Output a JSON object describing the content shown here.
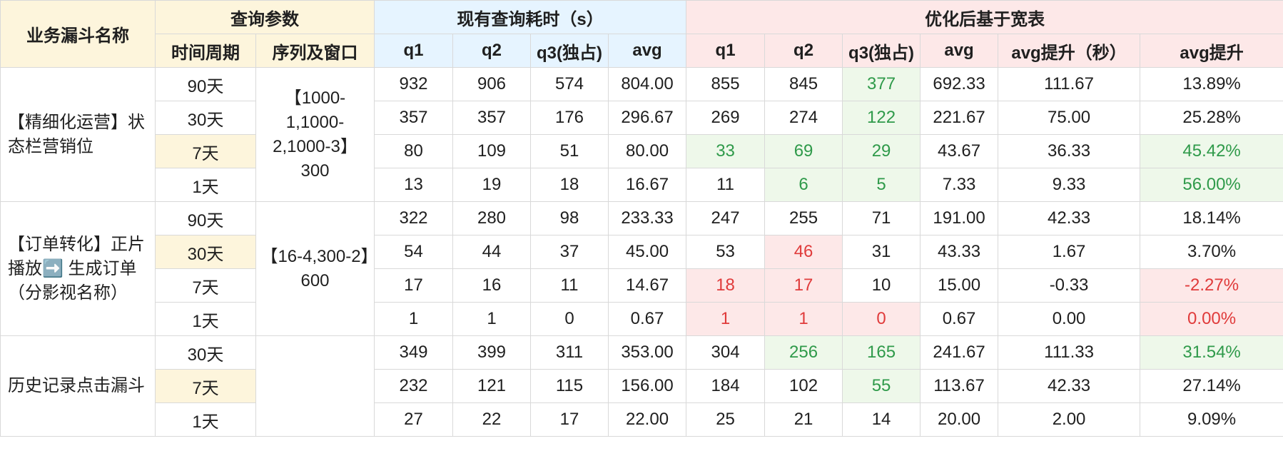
{
  "headers": {
    "business": "业务漏斗名称",
    "query_params": "查询参数",
    "current": "现有查询耗时（s）",
    "optimized": "优化后基于宽表",
    "period": "时间周期",
    "sequence_window": "序列及窗口",
    "current_cols": [
      "q1",
      "q2",
      "q3(独占)",
      "avg"
    ],
    "optimized_cols": [
      "q1",
      "q2",
      "q3(独占)",
      "avg",
      "avg提升（秒）",
      "avg提升"
    ]
  },
  "colors": {
    "header_yellow": "#fdf5dc",
    "header_blue": "#e6f4ff",
    "header_pink": "#fde8e8",
    "highlight_green_bg": "#eef8ea",
    "highlight_green_text": "#2f9a4a",
    "highlight_red_bg": "#fde8e8",
    "highlight_red_text": "#e03b3b"
  },
  "groups": [
    {
      "name": "【精细化运营】状态栏营销位",
      "param": "【1000-1,1000-2,1000-3】300",
      "rows": [
        {
          "period": "90天",
          "cur": [
            "932",
            "906",
            "574",
            "804.00"
          ],
          "opt": [
            "855",
            "845",
            "377",
            "692.33",
            "111.67",
            "13.89%"
          ]
        },
        {
          "period": "30天",
          "cur": [
            "357",
            "357",
            "176",
            "296.67"
          ],
          "opt": [
            "269",
            "274",
            "122",
            "221.67",
            "75.00",
            "25.28%"
          ]
        },
        {
          "period": "7天",
          "cur": [
            "80",
            "109",
            "51",
            "80.00"
          ],
          "opt": [
            "33",
            "69",
            "29",
            "43.67",
            "36.33",
            "45.42%"
          ]
        },
        {
          "period": "1天",
          "cur": [
            "13",
            "19",
            "18",
            "16.67"
          ],
          "opt": [
            "11",
            "6",
            "5",
            "7.33",
            "9.33",
            "56.00%"
          ]
        }
      ]
    },
    {
      "name": "【订单转化】正片播放➡️ 生成订单（分影视名称）",
      "param": "【16-4,300-2】600",
      "rows": [
        {
          "period": "90天",
          "cur": [
            "322",
            "280",
            "98",
            "233.33"
          ],
          "opt": [
            "247",
            "255",
            "71",
            "191.00",
            "42.33",
            "18.14%"
          ]
        },
        {
          "period": "30天",
          "cur": [
            "54",
            "44",
            "37",
            "45.00"
          ],
          "opt": [
            "53",
            "46",
            "31",
            "43.33",
            "1.67",
            "3.70%"
          ]
        },
        {
          "period": "7天",
          "cur": [
            "17",
            "16",
            "11",
            "14.67"
          ],
          "opt": [
            "18",
            "17",
            "10",
            "15.00",
            "-0.33",
            "-2.27%"
          ]
        },
        {
          "period": "1天",
          "cur": [
            "1",
            "1",
            "0",
            "0.67"
          ],
          "opt": [
            "1",
            "1",
            "0",
            "0.67",
            "0.00",
            "0.00%"
          ]
        }
      ]
    },
    {
      "name": "历史记录点击漏斗",
      "param": "",
      "rows": [
        {
          "period": "30天",
          "cur": [
            "349",
            "399",
            "311",
            "353.00"
          ],
          "opt": [
            "304",
            "256",
            "165",
            "241.67",
            "111.33",
            "31.54%"
          ]
        },
        {
          "period": "7天",
          "cur": [
            "232",
            "121",
            "115",
            "156.00"
          ],
          "opt": [
            "184",
            "102",
            "55",
            "113.67",
            "42.33",
            "27.14%"
          ]
        },
        {
          "period": "1天",
          "cur": [
            "27",
            "22",
            "17",
            "22.00"
          ],
          "opt": [
            "25",
            "21",
            "14",
            "20.00",
            "2.00",
            "9.09%"
          ]
        }
      ]
    }
  ]
}
